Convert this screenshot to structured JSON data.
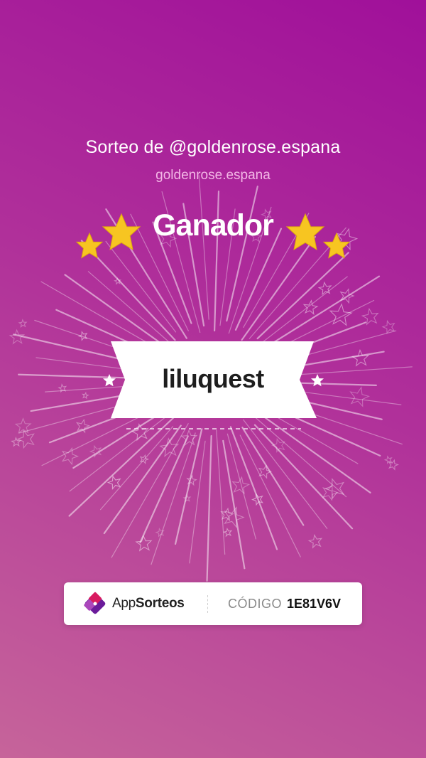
{
  "header": {
    "title": "Sorteo de @goldenrose.espana",
    "account": "goldenrose.espana",
    "winner_heading": "Ganador"
  },
  "winner": {
    "name": "liluquest"
  },
  "footer": {
    "brand_prefix": "App",
    "brand_suffix": "Sorteos",
    "code_label": "CÓDIGO",
    "code_value": "1E81V6V"
  },
  "colors": {
    "background_top": "#a0109a",
    "background_bottom": "#c6649a",
    "star_gold": "#f7c521",
    "subtitle_pink": "#f3b7e6"
  },
  "icons": [
    "gold-star-icon",
    "white-star-icon",
    "appsorteos-logo-icon"
  ]
}
